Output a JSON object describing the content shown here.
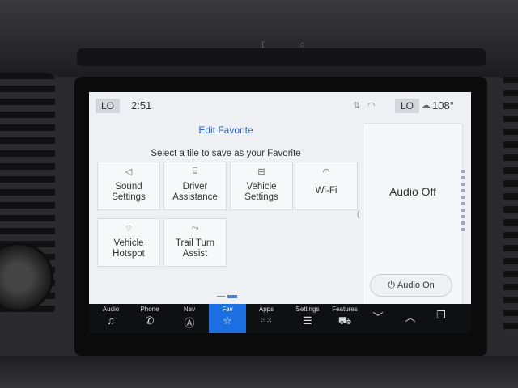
{
  "status": {
    "left_chip": "LO",
    "time": "2:51",
    "right_chip": "LO",
    "temperature": "108°",
    "icons": [
      "signal-icon",
      "wifi-icon",
      "weather-icon"
    ]
  },
  "header": {
    "title": "Edit Favorite",
    "subtitle": "Select a tile to save as your Favorite"
  },
  "tiles": [
    {
      "label": "Sound\nSettings",
      "icon": "speaker-icon"
    },
    {
      "label": "Driver\nAssistance",
      "icon": "driver-assist-icon"
    },
    {
      "label": "Vehicle\nSettings",
      "icon": "car-settings-icon"
    },
    {
      "label": "Wi-Fi",
      "icon": "wifi-icon"
    },
    {
      "label": "Vehicle\nHotspot",
      "icon": "hotspot-icon"
    },
    {
      "label": "Trail Turn\nAssist",
      "icon": "trail-turn-icon"
    }
  ],
  "audio_panel": {
    "status": "Audio Off",
    "button": "Audio On"
  },
  "nav": [
    {
      "label": "Audio",
      "icon": "music-note-icon"
    },
    {
      "label": "Phone",
      "icon": "phone-icon"
    },
    {
      "label": "Nav",
      "icon": "navigation-icon"
    },
    {
      "label": "Fav",
      "icon": "star-icon",
      "active": true
    },
    {
      "label": "Apps",
      "icon": "apps-grid-icon"
    },
    {
      "label": "Settings",
      "icon": "sliders-icon"
    },
    {
      "label": "Features",
      "icon": "truck-icon"
    },
    {
      "label": "",
      "icon": "chevron-down-icon"
    },
    {
      "label": "",
      "icon": "chevron-up-icon"
    },
    {
      "label": "",
      "icon": "copy-icon"
    }
  ],
  "colors": {
    "accent": "#1c6fe0",
    "title": "#2a62c8"
  }
}
